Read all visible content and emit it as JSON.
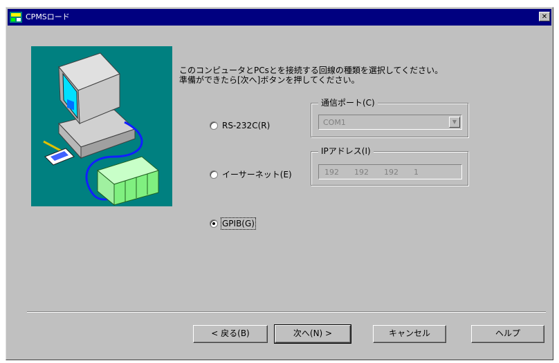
{
  "window": {
    "title": "CPMSロード",
    "close_glyph": "✕"
  },
  "instruction": "このコンピュータとPCsとを接続する回線の種類を選択してください。\n準備ができたら[次へ]ボタンを押してください。",
  "options": [
    {
      "label": "RS-232C(R)",
      "selected": false,
      "group_label": "通信ポート(C)",
      "value": "COM1"
    },
    {
      "label": "イーサーネット(E)",
      "selected": false,
      "group_label": "IPアドレス(I)",
      "ip": [
        "192",
        "192",
        "192",
        "1"
      ]
    },
    {
      "label": "GPIB(G)",
      "selected": true
    }
  ],
  "buttons": {
    "back": "< 戻る(B)",
    "next": "次へ(N) >",
    "cancel": "キャンセル",
    "help": "ヘルプ"
  },
  "icons": {
    "app": "app-icon",
    "close": "close-icon",
    "dropdown": "chevron-down-icon"
  },
  "colors": {
    "titlebar": "#000080",
    "dialog_bg": "#c0c0c0",
    "illustration_bg": "#008080"
  }
}
